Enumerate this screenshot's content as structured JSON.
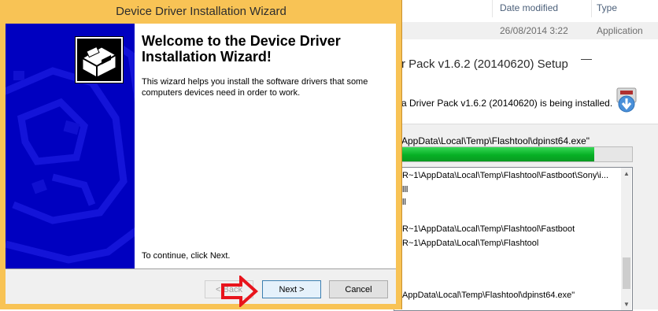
{
  "explorer": {
    "col_date": "Date modified",
    "col_type": "Type",
    "row": {
      "date": "26/08/2014 3:22",
      "type": "Application"
    }
  },
  "setup": {
    "title": "r Pack v1.6.2 (20140620) Setup",
    "minimize_label": "—",
    "status": "a Driver Pack v1.6.2 (20140620) is being installed.",
    "current_path": "AppData\\Local\\Temp\\Flashtool\\dpinst64.exe\"",
    "progress": 0.84,
    "log_lines": [
      "R~1\\AppData\\Local\\Temp\\Flashtool\\Fastboot\\Sony\\i...",
      "lll",
      "ll",
      "R~1\\AppData\\Local\\Temp\\Flashtool\\Fastboot",
      "R~1\\AppData\\Local\\Temp\\Flashtool",
      "AppData\\Local\\Temp\\Flashtool\\dpinst64.exe\""
    ]
  },
  "wizard": {
    "title": "Device Driver Installation Wizard",
    "heading": "Welcome to the Device Driver Installation Wizard!",
    "description": "This wizard helps you install the software drivers that some computers devices need in order to work.",
    "continue_text": "To continue, click Next.",
    "buttons": {
      "back": "< Back",
      "next": "Next >",
      "cancel": "Cancel"
    },
    "colors": {
      "banner": "#0000c0",
      "frame": "#f8c355",
      "annotation_arrow": "#e8141c"
    }
  }
}
